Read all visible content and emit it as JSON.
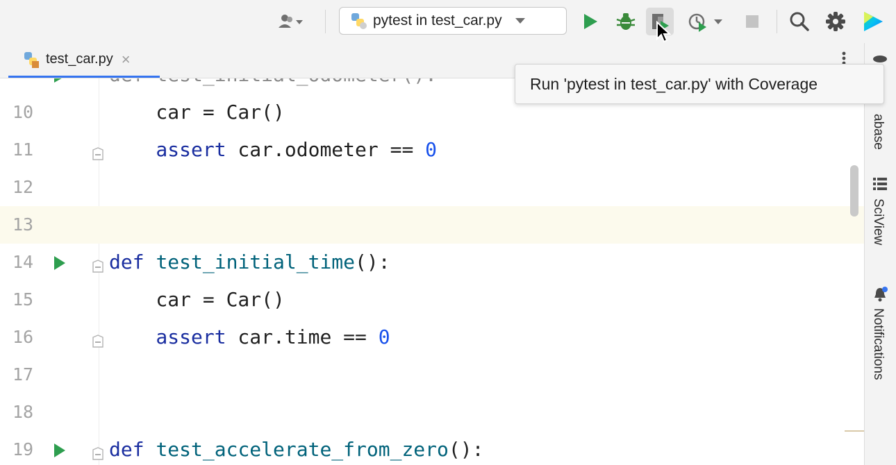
{
  "toolbar": {
    "run_config": {
      "label": "pytest in test_car.py",
      "icon": "python-pytest-icon",
      "dropdown_icon": "triangle-down-icon"
    },
    "icons": [
      "user-icon",
      "run-icon",
      "debug-bug-icon",
      "run-with-coverage-icon",
      "profile-icon",
      "stop-icon",
      "search-icon",
      "gear-icon",
      "jetbrains-logo-icon"
    ],
    "accent_color": "#3574f0",
    "run_color": "#2e9e4f"
  },
  "tab": {
    "label": "test_car.py",
    "close_symbol": "×",
    "icon": "python-file-icon"
  },
  "tooltip": {
    "text": "Run 'pytest in test_car.py' with Coverage"
  },
  "editor": {
    "clipped_line": "def test_initial_odometer():",
    "lines": [
      {
        "number": "10",
        "parts": [
          [
            "ident",
            "    car = Car()"
          ]
        ]
      },
      {
        "number": "11",
        "parts": [
          [
            "kw",
            "    assert"
          ],
          [
            "ident",
            " car.odometer == "
          ],
          [
            "num",
            "0"
          ]
        ]
      },
      {
        "number": "12",
        "parts": []
      },
      {
        "number": "13",
        "parts": []
      },
      {
        "number": "14",
        "parts": [
          [
            "kw",
            "def "
          ],
          [
            "fn",
            "test_initial_time"
          ],
          [
            "ident",
            "():"
          ]
        ]
      },
      {
        "number": "15",
        "parts": [
          [
            "ident",
            "    car = Car()"
          ]
        ]
      },
      {
        "number": "16",
        "parts": [
          [
            "kw",
            "    assert"
          ],
          [
            "ident",
            " car.time == "
          ],
          [
            "num",
            "0"
          ]
        ]
      },
      {
        "number": "17",
        "parts": []
      },
      {
        "number": "18",
        "parts": []
      },
      {
        "number": "19",
        "parts": [
          [
            "kw",
            "def "
          ],
          [
            "fn",
            "test_accelerate_from_zero"
          ],
          [
            "ident",
            "():"
          ]
        ]
      }
    ],
    "current_line": "13",
    "run_gutter_lines": [
      "14",
      "19"
    ],
    "fold_lines": [
      "11",
      "14",
      "16",
      "19"
    ]
  },
  "right_strip": {
    "labels": {
      "database": "abase",
      "sciview": "SciView",
      "notifications": "Notifications"
    },
    "icons": [
      "database-icon",
      "sciview-icon",
      "notifications-bell-icon"
    ]
  }
}
